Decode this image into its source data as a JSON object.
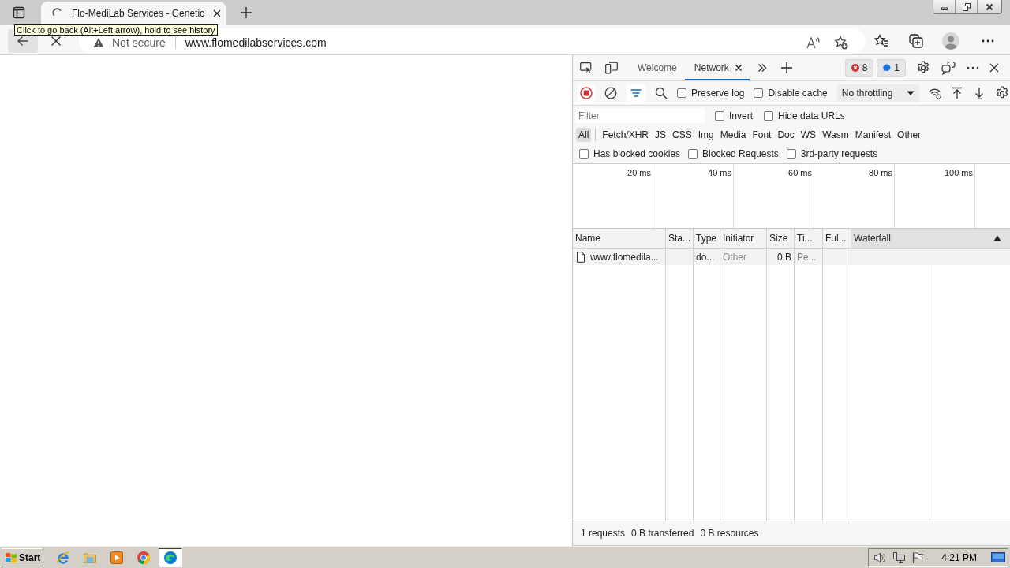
{
  "browser": {
    "tab": {
      "title": "Flo-MediLab Services - Genetic",
      "selected": true
    },
    "tooltip": "Click to go back (Alt+Left arrow), hold to see history",
    "address_bar": {
      "security": "Not secure",
      "url": "www.flomedilabservices.com"
    }
  },
  "devtools": {
    "tabs": [
      {
        "label": "Welcome",
        "selected": false,
        "closable": false
      },
      {
        "label": "Network",
        "selected": true,
        "closable": true
      }
    ],
    "badges": [
      {
        "kind": "error",
        "count": "8"
      },
      {
        "kind": "info",
        "count": "1"
      }
    ],
    "recording": true,
    "toolbar_options": [
      {
        "label": "Preserve log",
        "checked": false
      },
      {
        "label": "Disable cache",
        "checked": false
      }
    ],
    "throttling": "No throttling",
    "filter": {
      "placeholder": "Filter"
    },
    "filter_options": [
      {
        "label": "Invert",
        "checked": false
      },
      {
        "label": "Hide data URLs",
        "checked": false
      }
    ],
    "type_filters": [
      {
        "label": "All",
        "selected": true
      },
      {
        "label": "Fetch/XHR",
        "selected": false
      },
      {
        "label": "JS",
        "selected": false
      },
      {
        "label": "CSS",
        "selected": false
      },
      {
        "label": "Img",
        "selected": false
      },
      {
        "label": "Media",
        "selected": false
      },
      {
        "label": "Font",
        "selected": false
      },
      {
        "label": "Doc",
        "selected": false
      },
      {
        "label": "WS",
        "selected": false
      },
      {
        "label": "Wasm",
        "selected": false
      },
      {
        "label": "Manifest",
        "selected": false
      },
      {
        "label": "Other",
        "selected": false
      }
    ],
    "request_filters": [
      {
        "label": "Has blocked cookies",
        "checked": false
      },
      {
        "label": "Blocked Requests",
        "checked": false
      },
      {
        "label": "3rd-party requests",
        "checked": false
      }
    ],
    "overview_ticks": [
      "20 ms",
      "40 ms",
      "60 ms",
      "80 ms",
      "100 ms"
    ],
    "table": {
      "columns": [
        {
          "label": "Name",
          "sorted": false
        },
        {
          "label": "Sta...",
          "sorted": false
        },
        {
          "label": "Type",
          "sorted": false
        },
        {
          "label": "Initiator",
          "sorted": false
        },
        {
          "label": "Size",
          "sorted": false
        },
        {
          "label": "Ti...",
          "sorted": false
        },
        {
          "label": "Ful...",
          "sorted": false
        },
        {
          "label": "Waterfall",
          "sorted": true
        }
      ],
      "rows": [
        {
          "name": "www.flomedila...",
          "type": "do...",
          "initiator": "Other",
          "size": "0 B",
          "time": "Pe..."
        }
      ]
    },
    "status_bar": [
      "1 requests",
      "0 B transferred",
      "0 B resources"
    ]
  },
  "taskbar": {
    "start": "Start",
    "apps": [
      {
        "kind": "ie",
        "active": false
      },
      {
        "kind": "folder",
        "active": false
      },
      {
        "kind": "media",
        "active": false
      },
      {
        "kind": "chrome",
        "active": false
      },
      {
        "kind": "edge",
        "active": true
      }
    ],
    "clock": "4:21 PM"
  }
}
